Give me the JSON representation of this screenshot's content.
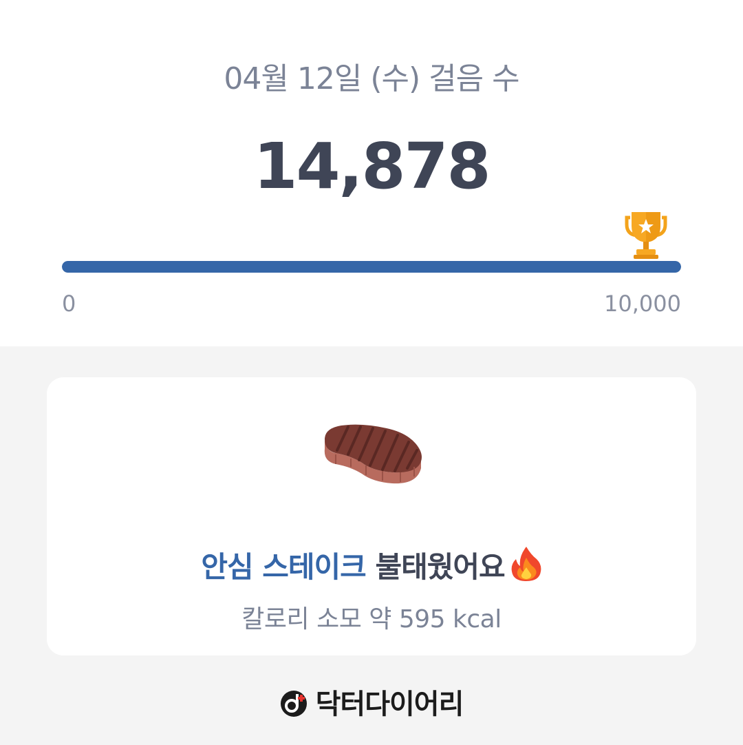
{
  "header": {
    "date_title": "04월 12일 (수) 걸음 수",
    "step_count": "14,878"
  },
  "progress": {
    "min_label": "0",
    "max_label": "10,000",
    "fill_fraction": 1.0,
    "goal_icon": "trophy-icon"
  },
  "card": {
    "food_icon": "steak-icon",
    "food_name": "안심 스테이크",
    "burn_text": "불태웠어요",
    "fire_icon": "fire-icon",
    "calorie_text": "칼로리 소모 약 595 kcal"
  },
  "brand": {
    "name": "닥터다이어리"
  },
  "colors": {
    "accent": "#3566a8",
    "text_dark": "#3f4556",
    "text_muted": "#7b8396",
    "background": "#f4f4f4"
  }
}
